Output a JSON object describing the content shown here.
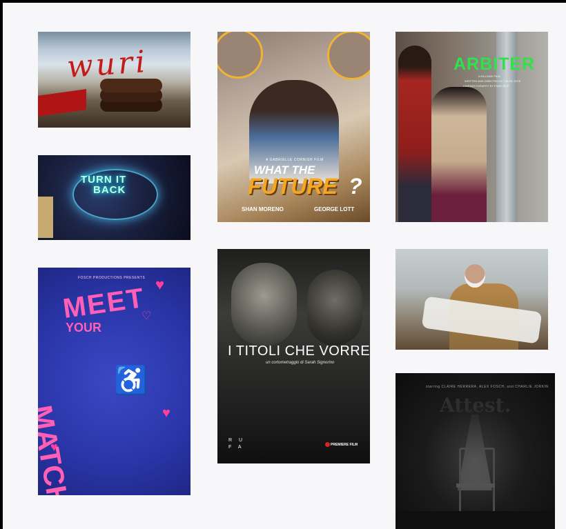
{
  "gallery": {
    "tiles": [
      {
        "id": "wuri",
        "title": "wuri"
      },
      {
        "id": "turn-it-back",
        "title_lines": [
          "TURN IT",
          "BACK"
        ]
      },
      {
        "id": "what-the-future",
        "byline": "A GABRIELLE CORNISH FILM",
        "title_line1": "WHAT THE",
        "title_line2": "FUTURE",
        "title_mark": "?",
        "cast": [
          "SHAN MORENO",
          "GEORGE LOTT"
        ]
      },
      {
        "id": "arbiter",
        "title": "ARBITER",
        "subtitle_lines": [
          "A HILLSIDE FILM",
          "WRITTEN AND DIRECTED BY CALEB JOYE",
          "CINEMATOGRAPHY BY EVAN JELP"
        ]
      },
      {
        "id": "meet-your-match",
        "producer": "FOSCH PRODUCTIONS PRESENTS",
        "title_meet": "MEET",
        "title_your_lines": [
          "YOUR"
        ],
        "title_match": "MATCH"
      },
      {
        "id": "i-titoli-che-vorrei",
        "title": "I TITOLI CHE VORREI",
        "subtitle": "un cortometraggio di Sarah Signorino",
        "studio_lines": [
          "R U",
          "F A"
        ],
        "distributor": "PREMIERE FILM"
      },
      {
        "id": "old-man-still"
      },
      {
        "id": "attest",
        "credits": "starring CLAIRE HERRERA, ALEX FOSCH, and CHARLIE JORKIN",
        "title": "Attest."
      }
    ]
  },
  "colors": {
    "page_bg": "#f7f7f9",
    "frame_border": "#000000",
    "future_accent": "#f5a623",
    "arbiter_green": "#2fe24a",
    "match_pink": "#ff5fb4"
  }
}
